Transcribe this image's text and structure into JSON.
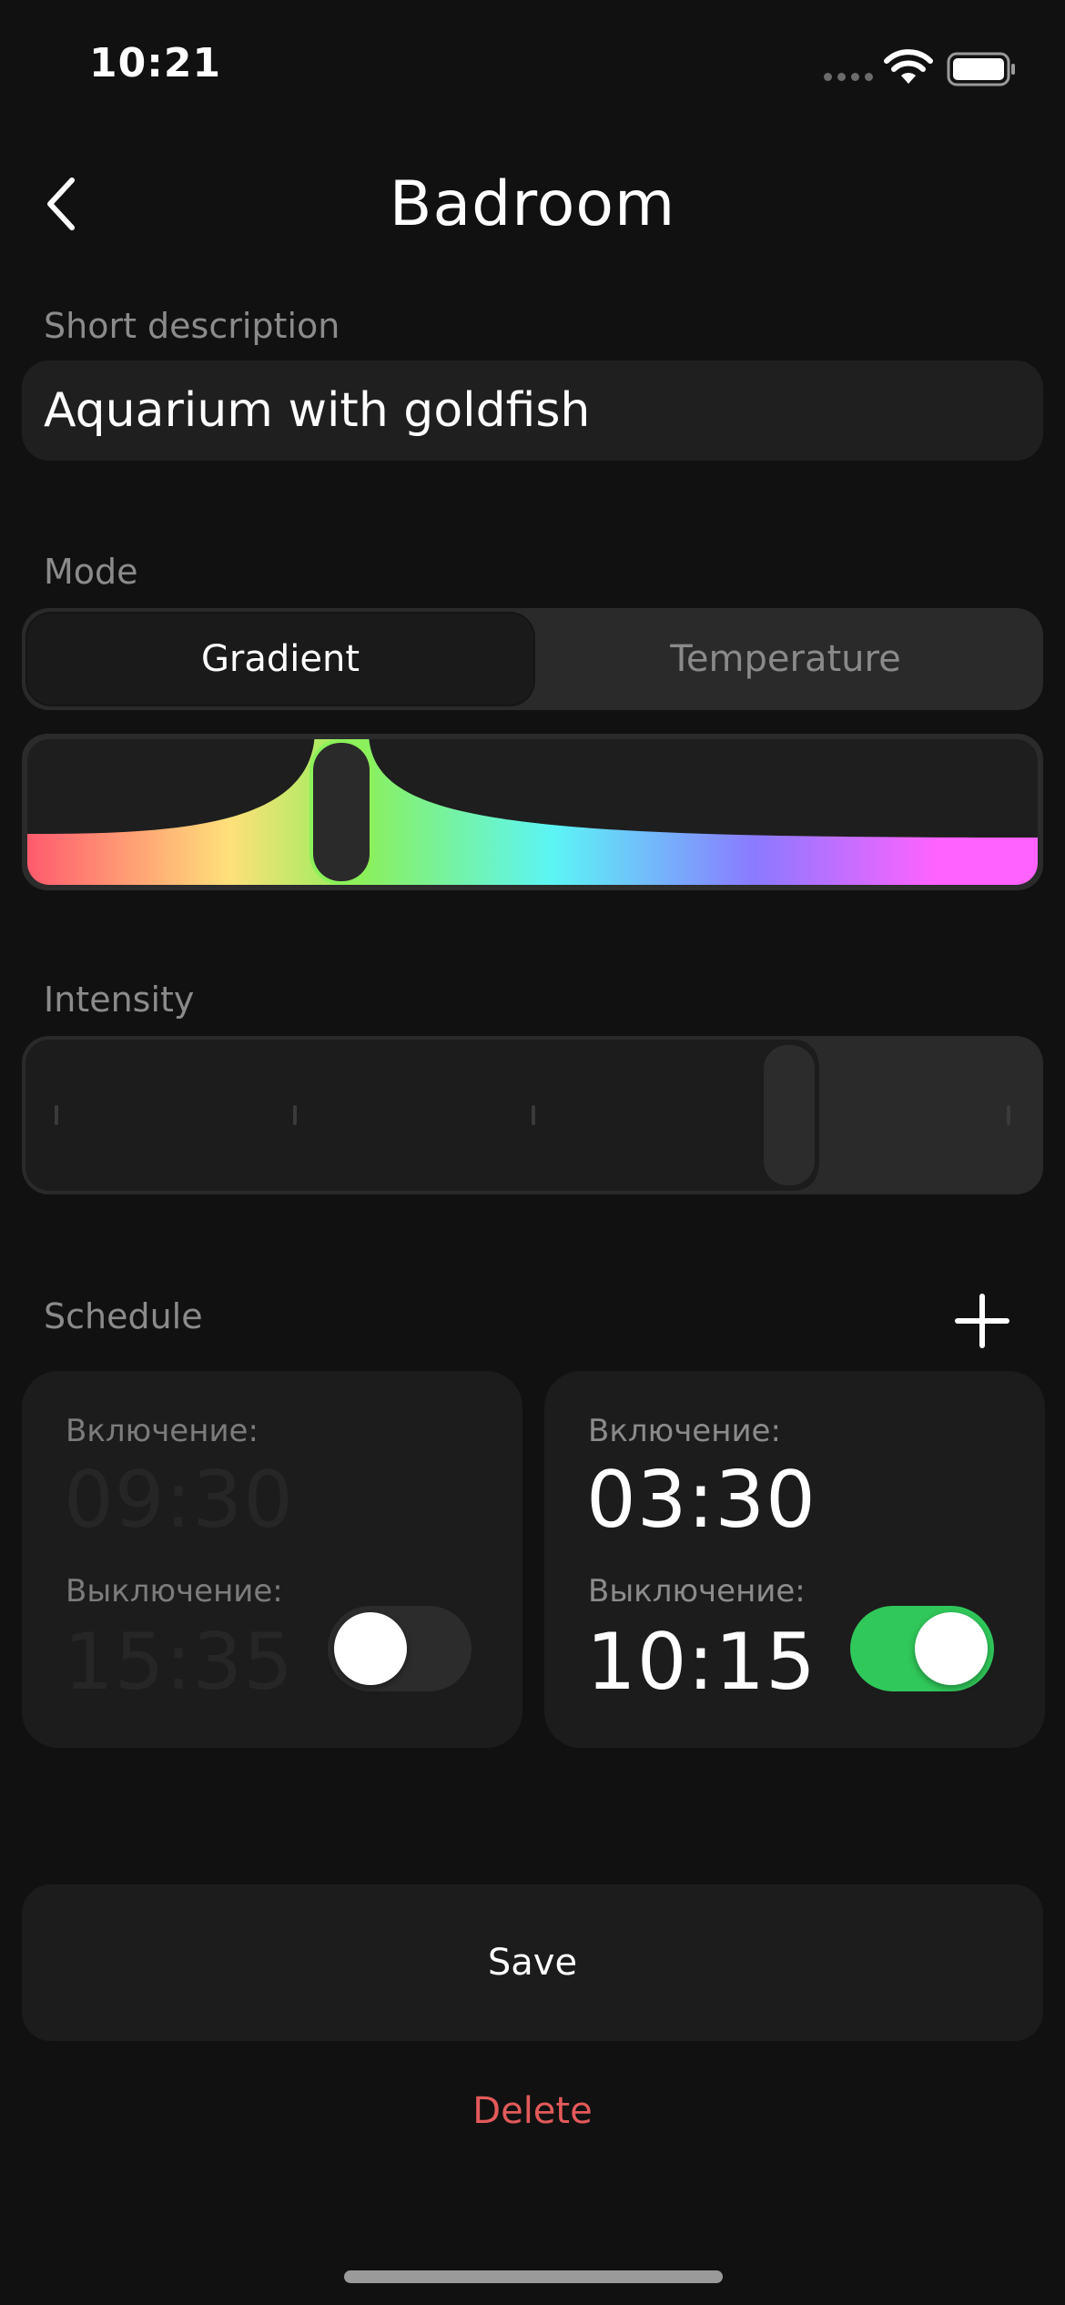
{
  "status_bar": {
    "time": "10:21"
  },
  "header": {
    "title": "Badroom"
  },
  "description": {
    "label": "Short description",
    "value": "Aquarium with goldfish"
  },
  "mode": {
    "label": "Mode",
    "options": [
      "Gradient",
      "Temperature"
    ],
    "selected": "Gradient",
    "gradient_position": 0.3
  },
  "intensity": {
    "label": "Intensity",
    "level": 0.77
  },
  "schedule": {
    "label": "Schedule",
    "cards": [
      {
        "on_label": "Включение:",
        "on_time": "09:30",
        "off_label": "Выключение:",
        "off_time": "15:35",
        "enabled": false
      },
      {
        "on_label": "Включение:",
        "on_time": "03:30",
        "off_label": "Выключение:",
        "off_time": "10:15",
        "enabled": true
      }
    ]
  },
  "actions": {
    "save_label": "Save",
    "delete_label": "Delete"
  },
  "colors": {
    "accent_green": "#30c85a",
    "delete_red": "#e35a5a",
    "background": "#111111"
  }
}
